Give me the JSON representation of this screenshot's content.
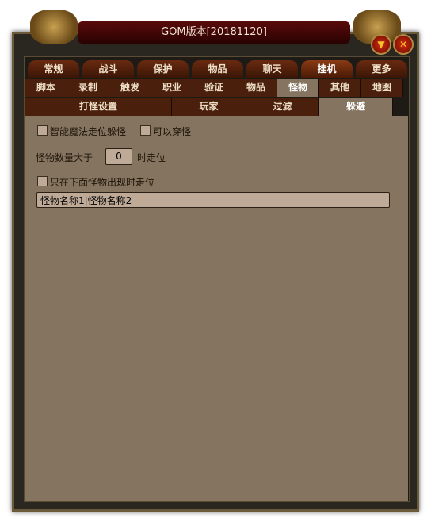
{
  "window": {
    "title": "GOM版本[20181120]"
  },
  "tabs_main": [
    {
      "label": "常规"
    },
    {
      "label": "战斗"
    },
    {
      "label": "保护"
    },
    {
      "label": "物品"
    },
    {
      "label": "聊天"
    },
    {
      "label": "挂机",
      "active": true
    },
    {
      "label": "更多"
    }
  ],
  "tabs_sub": [
    {
      "label": "脚本"
    },
    {
      "label": "录制"
    },
    {
      "label": "触发"
    },
    {
      "label": "职业"
    },
    {
      "label": "验证"
    },
    {
      "label": "物品"
    },
    {
      "label": "怪物",
      "active": true
    },
    {
      "label": "其他"
    },
    {
      "label": "地图"
    }
  ],
  "tabs_third": [
    {
      "label": "打怪设置"
    },
    {
      "label": "玩家"
    },
    {
      "label": "过滤"
    },
    {
      "label": "躲避",
      "active": true
    }
  ],
  "options": {
    "smart_dodge": {
      "label": "智能魔法走位躲怪",
      "checked": false
    },
    "pass_through": {
      "label": "可以穿怪",
      "checked": false
    },
    "count_prefix": "怪物数量大于",
    "count_value": "0",
    "count_suffix": "时走位",
    "only_listed": {
      "label": "只在下面怪物出现时走位",
      "checked": false
    },
    "monster_names": "怪物名称1|怪物名称2"
  }
}
